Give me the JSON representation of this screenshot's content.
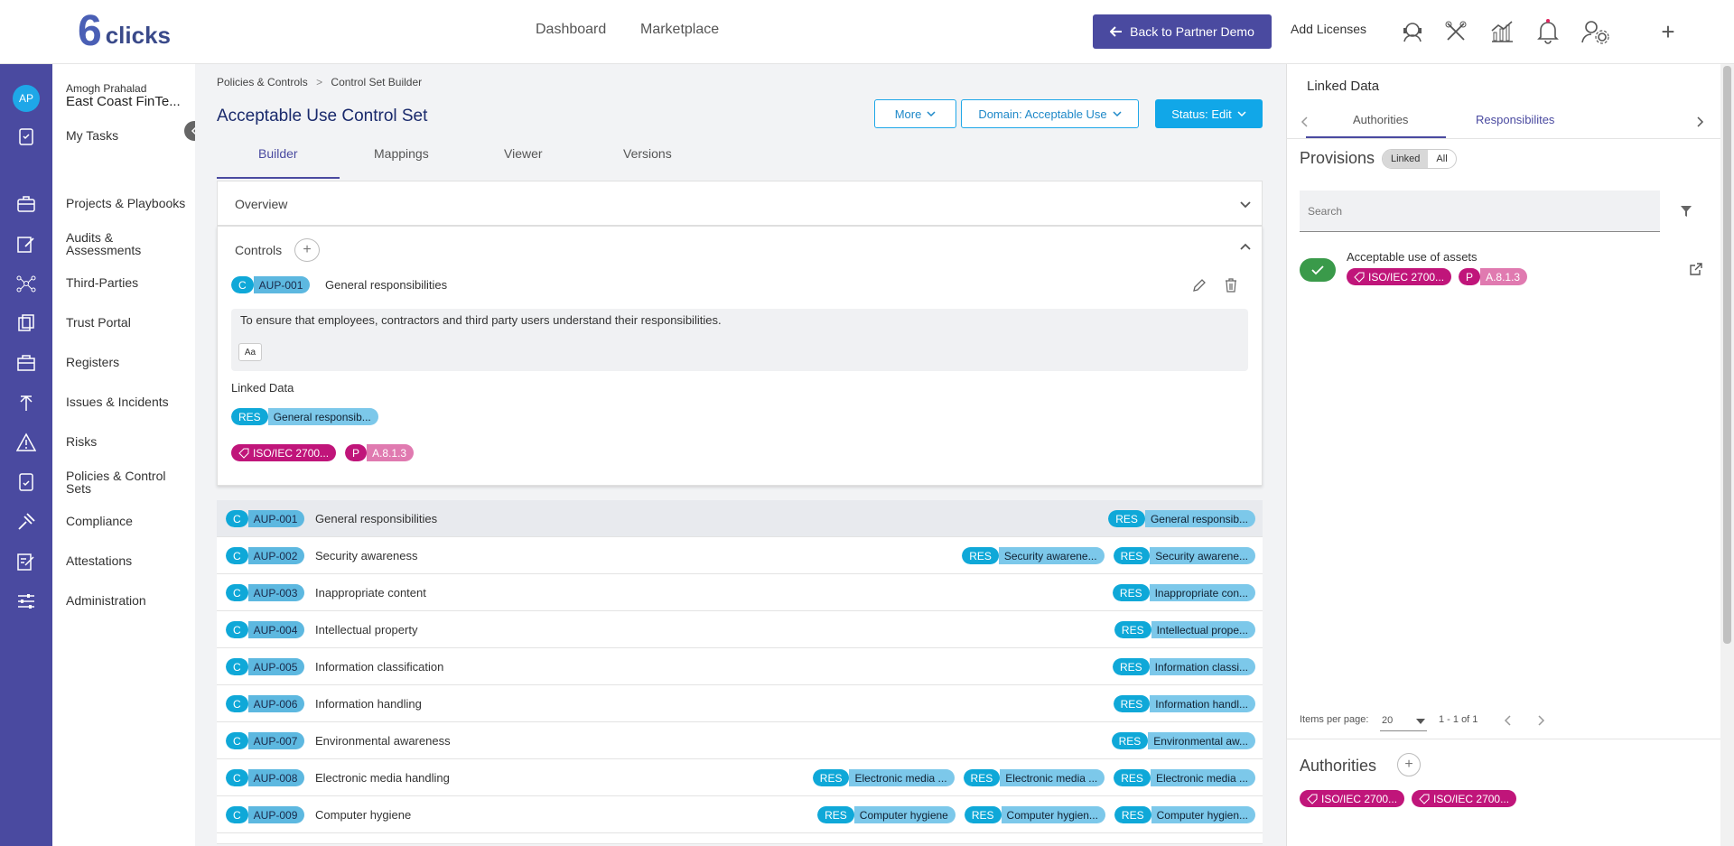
{
  "header": {
    "logo_mark": "6",
    "logo_text": "clicks",
    "nav": [
      "Dashboard",
      "Marketplace"
    ],
    "back_button": "Back to Partner Demo",
    "add_licenses": "Add Licenses",
    "plus": "+"
  },
  "user": {
    "initials": "AP",
    "name": "Amogh Prahalad",
    "org": "East Coast FinTe..."
  },
  "sidebar": {
    "my_tasks": "My Tasks",
    "items": [
      "Projects & Playbooks",
      "Audits & Assessments",
      "Third-Parties",
      "Trust Portal",
      "Registers",
      "Issues & Incidents",
      "Risks",
      "Policies & Control Sets",
      "Compliance",
      "Attestations",
      "Administration"
    ]
  },
  "breadcrumb": {
    "parent": "Policies & Controls",
    "sep": ">",
    "current": "Control Set Builder"
  },
  "page": {
    "title": "Acceptable Use Control Set",
    "more_button": "More",
    "domain_button": "Domain: Acceptable Use",
    "status_button": "Status: Edit"
  },
  "tabs": [
    "Builder",
    "Mappings",
    "Viewer",
    "Versions"
  ],
  "overview": {
    "title": "Overview"
  },
  "controls": {
    "title": "Controls",
    "plus": "+",
    "selected": {
      "prefix": "C",
      "code": "AUP-001",
      "name": "General responsibilities",
      "description": "To ensure that employees, contractors and third party users understand their responsibilities.",
      "aa": "Aa",
      "linked_title": "Linked Data",
      "res_key": "RES",
      "res_value": "General responsib...",
      "iso": "ISO/IEC 2700...",
      "p_key": "P",
      "p_value": "A.8.1.3"
    }
  },
  "rows": [
    {
      "prefix": "C",
      "code": "AUP-001",
      "name": "General responsibilities",
      "tags": [
        {
          "k": "RES",
          "v": "General responsib..."
        }
      ]
    },
    {
      "prefix": "C",
      "code": "AUP-002",
      "name": "Security awareness",
      "tags": [
        {
          "k": "RES",
          "v": "Security awarene..."
        },
        {
          "k": "RES",
          "v": "Security awarene..."
        }
      ]
    },
    {
      "prefix": "C",
      "code": "AUP-003",
      "name": "Inappropriate content",
      "tags": [
        {
          "k": "RES",
          "v": "Inappropriate con..."
        }
      ]
    },
    {
      "prefix": "C",
      "code": "AUP-004",
      "name": "Intellectual property",
      "tags": [
        {
          "k": "RES",
          "v": "Intellectual prope..."
        }
      ]
    },
    {
      "prefix": "C",
      "code": "AUP-005",
      "name": "Information classification",
      "tags": [
        {
          "k": "RES",
          "v": "Information classi..."
        }
      ]
    },
    {
      "prefix": "C",
      "code": "AUP-006",
      "name": "Information handling",
      "tags": [
        {
          "k": "RES",
          "v": "Information handl..."
        }
      ]
    },
    {
      "prefix": "C",
      "code": "AUP-007",
      "name": "Environmental awareness",
      "tags": [
        {
          "k": "RES",
          "v": "Environmental aw..."
        }
      ]
    },
    {
      "prefix": "C",
      "code": "AUP-008",
      "name": "Electronic media handling",
      "tags": [
        {
          "k": "RES",
          "v": "Electronic media ..."
        },
        {
          "k": "RES",
          "v": "Electronic media ..."
        },
        {
          "k": "RES",
          "v": "Electronic media ..."
        }
      ]
    },
    {
      "prefix": "C",
      "code": "AUP-009",
      "name": "Computer hygiene",
      "tags": [
        {
          "k": "RES",
          "v": "Computer hygiene"
        },
        {
          "k": "RES",
          "v": "Computer hygien..."
        },
        {
          "k": "RES",
          "v": "Computer hygien..."
        }
      ]
    }
  ],
  "right_panel": {
    "title": "Linked Data",
    "tabs": [
      "Authorities",
      "Responsibilites"
    ],
    "provisions_title": "Provisions",
    "toggle": [
      "Linked",
      "All"
    ],
    "search_placeholder": "Search",
    "item": {
      "name": "Acceptable use of assets",
      "iso": "ISO/IEC 2700...",
      "p_key": "P",
      "p_value": "A.8.1.3"
    },
    "items_per_page_label": "Items per page:",
    "items_per_page": "20",
    "range": "1 - 1 of 1",
    "authorities_title": "Authorities",
    "authorities": [
      "ISO/IEC 2700...",
      "ISO/IEC 2700..."
    ]
  },
  "colors": {
    "primary": "#4a4aa0",
    "accent": "#11a7e8",
    "iso": "#c0157a"
  }
}
